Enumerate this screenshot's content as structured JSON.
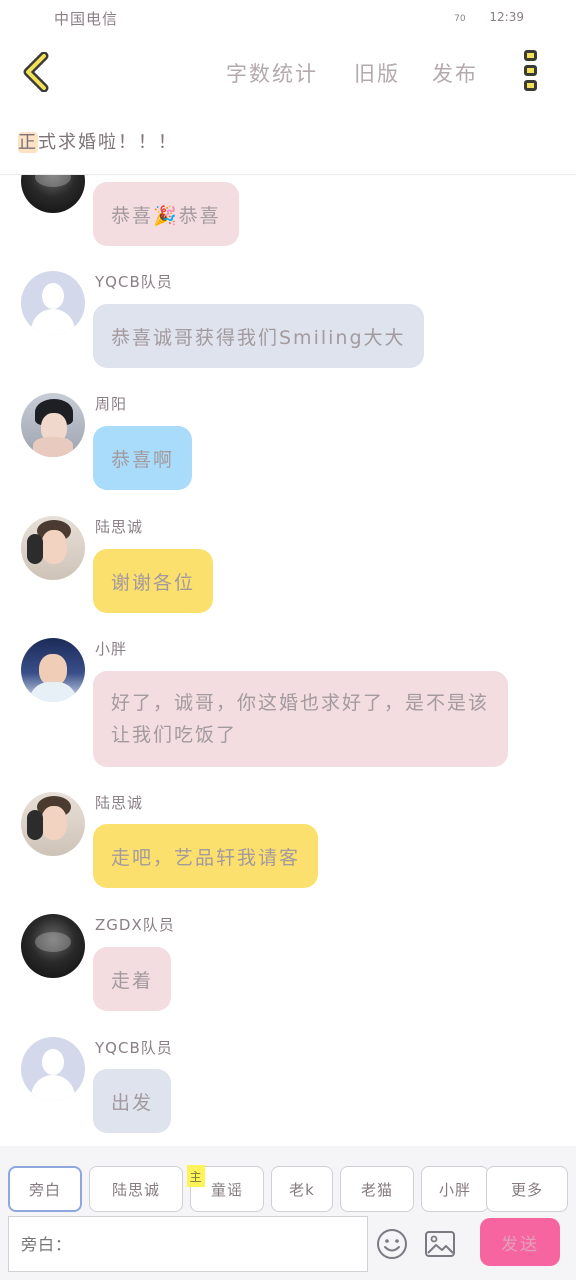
{
  "status_bar": {
    "carrier": "中国电信",
    "signal": "70",
    "time": "12:39"
  },
  "nav": {
    "word_count": "字数统计",
    "old_version": "旧版",
    "publish": "发布"
  },
  "chat_title": {
    "first_char": "正",
    "rest": "式求婚啦！！！"
  },
  "messages": [
    {
      "sender": "",
      "text": "恭喜🎉恭喜",
      "bubble_color": "#f4dde1",
      "avatar": "dark-photo"
    },
    {
      "sender": "YQCB队员",
      "text": "恭喜诚哥获得我们Smiling大大",
      "bubble_color": "#dfe3ed",
      "avatar": "default-user-icon"
    },
    {
      "sender": "周阳",
      "text": "恭喜啊",
      "bubble_color": "#a9dcfa",
      "avatar": "photo"
    },
    {
      "sender": "陆思诚",
      "text": "谢谢各位",
      "bubble_color": "#fce06e",
      "avatar": "photo"
    },
    {
      "sender": "小胖",
      "text": "好了，诚哥，你这婚也求好了，是不是该让我们吃饭了",
      "bubble_color": "#f4dde1",
      "avatar": "photo"
    },
    {
      "sender": "陆思诚",
      "text": "走吧，艺品轩我请客",
      "bubble_color": "#fce06e",
      "avatar": "photo"
    },
    {
      "sender": "ZGDX队员",
      "text": "走着",
      "bubble_color": "#f4dde1",
      "avatar": "dark-photo"
    },
    {
      "sender": "YQCB队员",
      "text": "出发",
      "bubble_color": "#dfe3ed",
      "avatar": "default-user-icon"
    }
  ],
  "roles": {
    "items": [
      "旁白",
      "陆思诚",
      "童谣",
      "老k",
      "老猫",
      "小胖",
      "更多"
    ],
    "host_badge": "主"
  },
  "composer": {
    "placeholder": "旁白：",
    "send": "发送"
  },
  "colors": {
    "accent": "#f765a0",
    "active_tab_border": "#8ea8de",
    "back_icon": "#f4e05a"
  }
}
